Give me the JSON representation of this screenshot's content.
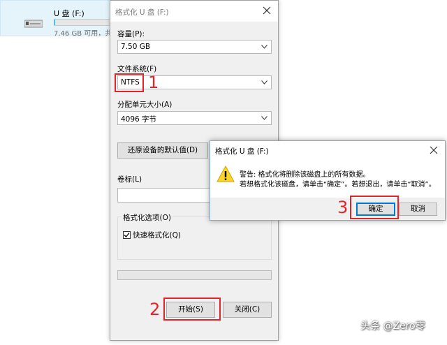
{
  "explorer": {
    "drive_name": "U 盘 (F:)",
    "drive_free": "7.46 GB 可用，共",
    "drive_used_fraction": 0.01
  },
  "format_dialog": {
    "title": "格式化 U 盘 (F:)",
    "capacity_label": "容量(P):",
    "capacity_value": "7.50 GB",
    "filesystem_label": "文件系统(F)",
    "filesystem_value": "NTFS",
    "allocation_label": "分配单元大小(A)",
    "allocation_value": "4096 字节",
    "restore_defaults_button": "还原设备的默认值(D)",
    "volume_label": "卷标(L)",
    "volume_value": "",
    "format_options_label": "格式化选项(O)",
    "quick_format_label": "快速格式化(Q)",
    "quick_format_checked": true,
    "progress_fraction": 0,
    "start_button": "开始(S)",
    "close_button": "关闭(C)"
  },
  "warning_dialog": {
    "title": "格式化 U 盘 (F:)",
    "line1": "警告: 格式化将删除该磁盘上的所有数据。",
    "line2": "若想格式化该磁盘，请单击“确定”。若想退出，请单击“取消”。",
    "ok_button": "确定",
    "cancel_button": "取消"
  },
  "annotations": {
    "step1": "1",
    "step2": "2",
    "step3": "3",
    "color": "#e0262b"
  },
  "watermark": "头条 @Zero零"
}
